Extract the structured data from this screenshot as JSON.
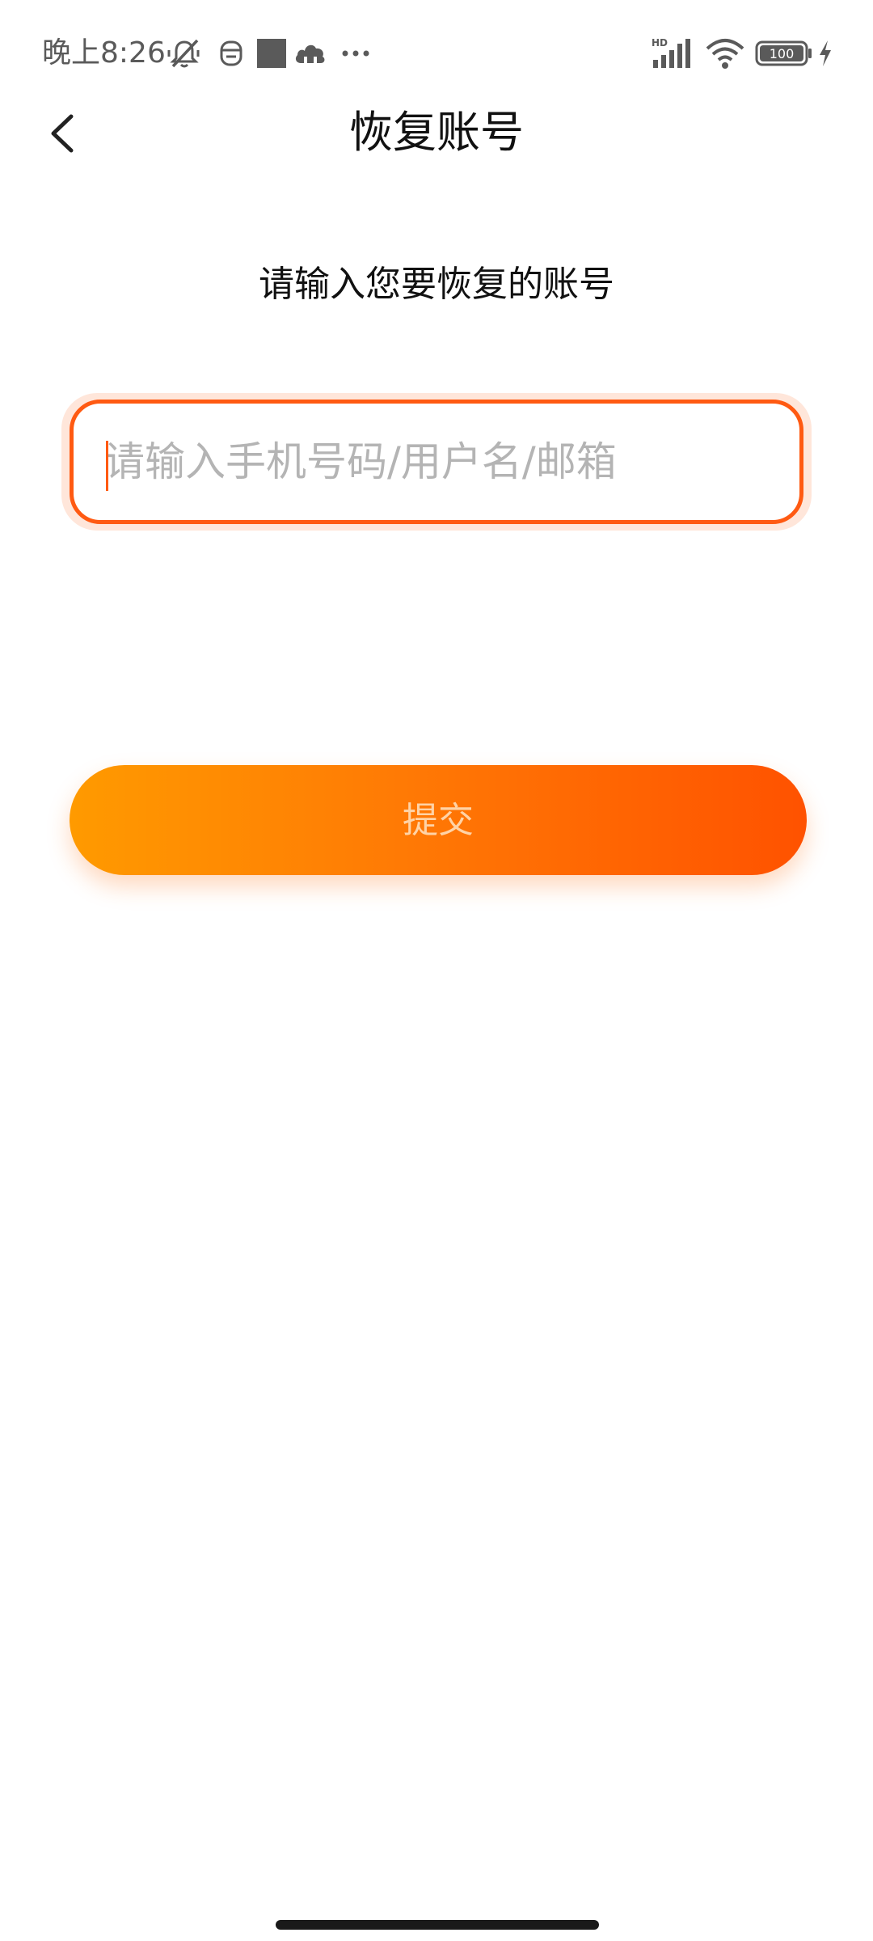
{
  "status_bar": {
    "time": "晚上8:26",
    "battery_level": "100",
    "network_label": "HD",
    "icons": [
      "silent-mode-icon",
      "robot-icon",
      "square-notification-icon",
      "cloud-icon",
      "more-dots-icon",
      "signal-icon",
      "wifi-icon",
      "battery-icon",
      "charging-icon"
    ]
  },
  "header": {
    "title": "恢复账号",
    "back_icon": "chevron-left-icon"
  },
  "main": {
    "prompt": "请输入您要恢复的账号",
    "account_input": {
      "placeholder": "请输入手机号码/用户名/邮箱",
      "value": ""
    },
    "submit_label": "提交"
  },
  "colors": {
    "accent": "#ff5a12",
    "gradient_start": "#ff9a00",
    "gradient_end": "#ff5200",
    "placeholder": "#b4b4b4",
    "submit_text": "#ffd3a6"
  }
}
